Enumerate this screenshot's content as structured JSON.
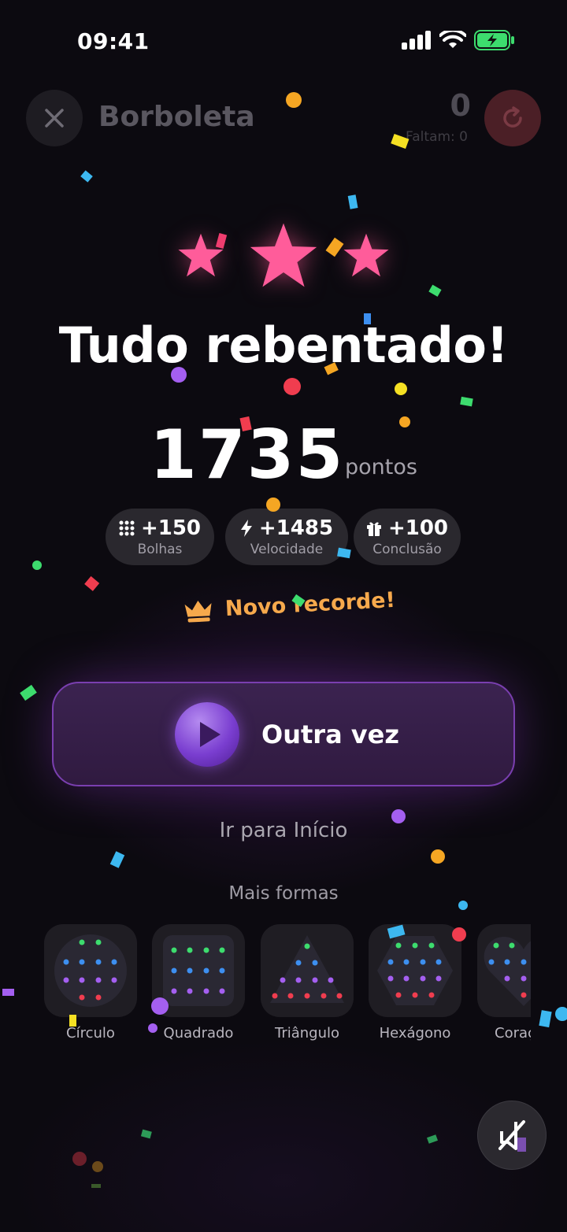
{
  "status_bar": {
    "time": "09:41"
  },
  "top_bar": {
    "level_name": "Borboleta",
    "score": "0",
    "remaining": "Faltam: 0"
  },
  "result": {
    "stars_earned": 3,
    "stars_total": 3,
    "title": "Tudo rebentado!",
    "score": "1735",
    "score_unit": "pontos"
  },
  "bonuses": [
    {
      "value": "+150",
      "label": "Bolhas",
      "icon": "grid-dots-icon"
    },
    {
      "value": "+1485",
      "label": "Velocidade",
      "icon": "lightning-icon"
    },
    {
      "value": "+100",
      "label": "Conclusão",
      "icon": "gift-icon"
    }
  ],
  "record": {
    "text": "Novo recorde!",
    "icon": "crown-icon"
  },
  "actions": {
    "again_label": "Outra vez",
    "home_label": "Ir para Início"
  },
  "more_shapes": {
    "title": "Mais formas",
    "items": [
      {
        "label": "Círculo",
        "icon": "circle-shape-icon"
      },
      {
        "label": "Quadrado",
        "icon": "square-shape-icon"
      },
      {
        "label": "Triângulo",
        "icon": "triangle-shape-icon"
      },
      {
        "label": "Hexágono",
        "icon": "hexagon-shape-icon"
      },
      {
        "label": "Coração",
        "icon": "heart-shape-icon"
      }
    ]
  },
  "sound": {
    "muted": true,
    "icon": "sound-off-icon"
  },
  "colors": {
    "background": "#0c0a10",
    "accent_purple": "#7a3fb0",
    "star_pink": "#ff5c9a",
    "record_orange": "#f6a94c",
    "restart_red": "#4b1f26",
    "bubble_green": "#3ddc6e",
    "bubble_blue": "#3d8ff0",
    "bubble_purple": "#a45ff0",
    "bubble_red": "#f03d4f"
  }
}
